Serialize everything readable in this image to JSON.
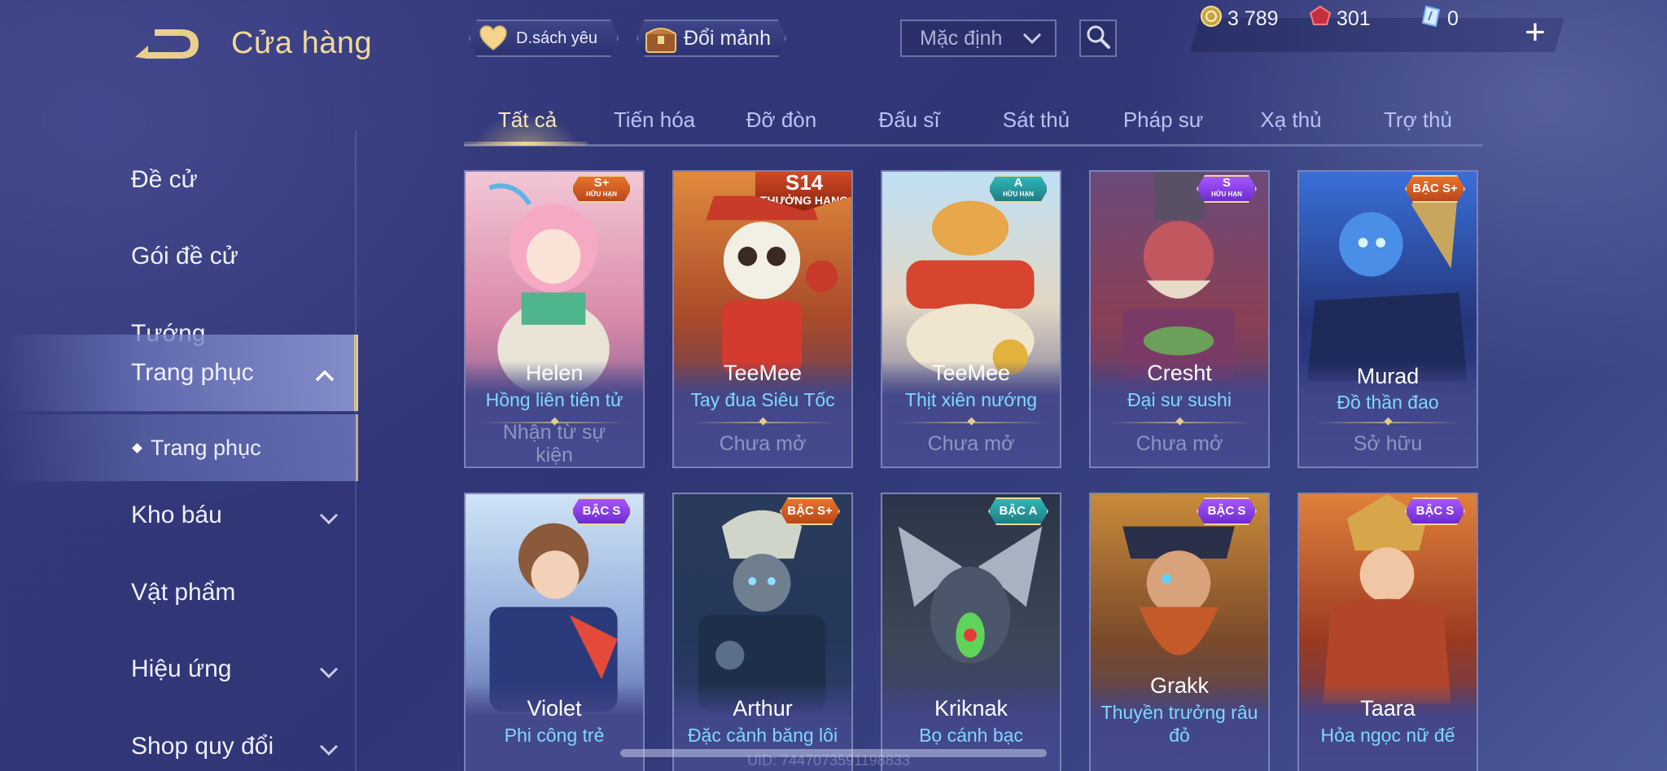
{
  "header": {
    "title": "Cửa hàng",
    "favorites_label": "D.sách yêu",
    "shard_exchange_label": "Đổi mảnh",
    "sort_value": "Mặc định",
    "currencies": {
      "gold": "3 789",
      "ruby": "301",
      "voucher": "0"
    },
    "plus_label": "+"
  },
  "sidebar": {
    "items": [
      {
        "label": "Đề cử"
      },
      {
        "label": "Gói đề cử"
      },
      {
        "label": "Tướng"
      },
      {
        "label": "Trang phục"
      },
      {
        "label": "Trang phục"
      },
      {
        "label": "Kho báu"
      },
      {
        "label": "Vật phẩm"
      },
      {
        "label": "Hiệu ứng"
      },
      {
        "label": "Shop quy đổi"
      }
    ]
  },
  "tabs": [
    "Tất cả",
    "Tiến hóa",
    "Đỡ đòn",
    "Đấu sĩ",
    "Sát thủ",
    "Pháp sư",
    "Xạ thủ",
    "Trợ thủ"
  ],
  "cards": [
    {
      "hero": "Helen",
      "skin": "Hồng liên tiên tử",
      "status": "Nhận từ sự kiện",
      "badge": "S+",
      "badge_sub": "HỮU HẠN",
      "badge_color": "#e8742b"
    },
    {
      "hero": "TeeMee",
      "skin": "Tay đua Siêu Tốc",
      "status": "Chưa mở",
      "badge": "S14",
      "badge_sub": "THƯỞNG HẠNG",
      "badge_color": "#d14a24"
    },
    {
      "hero": "TeeMee",
      "skin": "Thịt xiên nướng",
      "status": "Chưa mở",
      "badge": "A",
      "badge_sub": "HỮU HẠN",
      "badge_color": "#33b7b6"
    },
    {
      "hero": "Cresht",
      "skin": "Đại sư sushi",
      "status": "Chưa mở",
      "badge": "S",
      "badge_sub": "HỮU HẠN",
      "badge_color": "#a656ff"
    },
    {
      "hero": "Murad",
      "skin": "Đồ thần đao",
      "status": "Sở hữu",
      "badge": "BẬC S+",
      "badge_sub": "",
      "badge_color": "#e8742b"
    },
    {
      "hero": "Violet",
      "skin": "Phi công trẻ",
      "status": "",
      "badge": "BẬC S",
      "badge_sub": "",
      "badge_color": "#a656ff"
    },
    {
      "hero": "Arthur",
      "skin": "Đặc cảnh băng lôi",
      "status": "",
      "badge": "BẬC S+",
      "badge_sub": "",
      "badge_color": "#e8742b"
    },
    {
      "hero": "Kriknak",
      "skin": "Bọ cánh bạc",
      "status": "",
      "badge": "BẬC A",
      "badge_sub": "",
      "badge_color": "#33b7b6"
    },
    {
      "hero": "Grakk",
      "skin": "Thuyền trưởng râu đỏ",
      "status": "",
      "badge": "BẬC S",
      "badge_sub": "",
      "badge_color": "#a656ff"
    },
    {
      "hero": "Taara",
      "skin": "Hỏa ngọc nữ đế",
      "status": "",
      "badge": "BẬC S",
      "badge_sub": "",
      "badge_color": "#a656ff"
    }
  ],
  "footer": {
    "uid": "UID: 7447073591198833"
  }
}
